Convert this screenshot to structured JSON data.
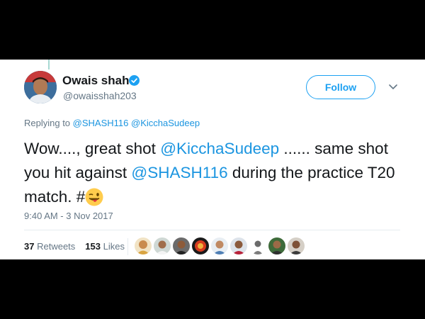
{
  "author": {
    "name": "Owais shah",
    "handle": "@owaisshah203",
    "verified": true,
    "verified_color": "#1da1f2"
  },
  "follow_button": {
    "label": "Follow",
    "color": "#1da1f2"
  },
  "reply_context": {
    "prefix": "Replying to",
    "mentions": [
      "@SHASH116",
      "@KicchaSudeep"
    ]
  },
  "tweet": {
    "part1": "Wow...., great shot ",
    "mention1": "@KicchaSudeep",
    "part2": " ...... same shot you hit against ",
    "mention2": "@SHASH116",
    "part3": " during the practice T20 match. #",
    "emoji": "winking-face-with-tongue"
  },
  "timestamp": "9:40 AM - 3 Nov 2017",
  "stats": {
    "retweets_count": "37",
    "retweets_label": "Retweets",
    "likes_count": "153",
    "likes_label": "Likes"
  },
  "liker_avatars_count": 9,
  "colors": {
    "link": "#1b95e0",
    "secondary": "#657786",
    "text": "#14171a"
  }
}
